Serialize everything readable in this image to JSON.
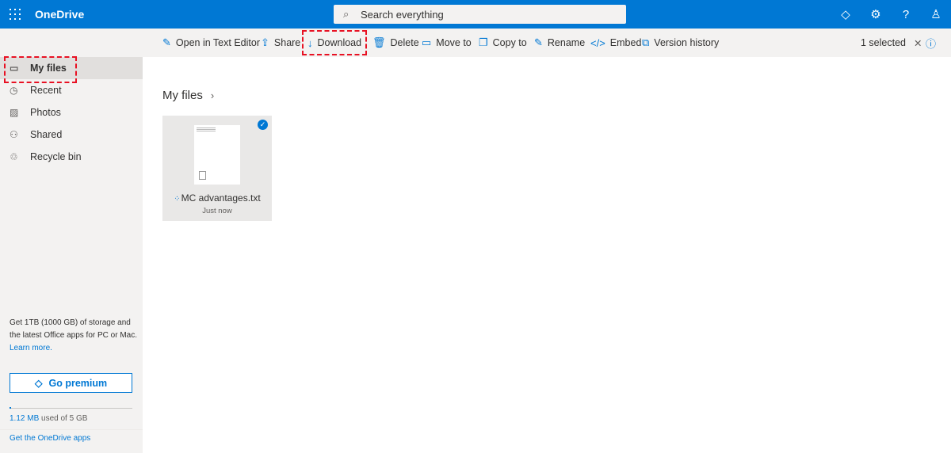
{
  "header": {
    "app_name": "OneDrive",
    "search_placeholder": "Search everything",
    "icons": [
      "diamond-icon",
      "gear-icon",
      "help-icon",
      "person-icon"
    ]
  },
  "toolbar": {
    "open_text_editor": "Open in Text Editor",
    "share": "Share",
    "download": "Download",
    "delete": "Delete",
    "move_to": "Move to",
    "copy_to": "Copy to",
    "rename": "Rename",
    "embed": "Embed",
    "version_history": "Version history",
    "selected": "1 selected"
  },
  "sidebar": {
    "items": [
      {
        "label": "My files",
        "icon": "folder-icon"
      },
      {
        "label": "Recent",
        "icon": "clock-icon"
      },
      {
        "label": "Photos",
        "icon": "image-icon"
      },
      {
        "label": "Shared",
        "icon": "people-icon"
      },
      {
        "label": "Recycle bin",
        "icon": "trash-icon"
      }
    ],
    "promo": "Get 1TB (1000 GB) of storage and the latest Office apps for PC or Mac.",
    "learn_more": "Learn more.",
    "go_premium": "Go premium",
    "storage_used": "1.12 MB",
    "storage_rest": "used of 5 GB",
    "storage_fraction": 0.0002,
    "get_apps": "Get the OneDrive apps"
  },
  "main": {
    "breadcrumb": "My files",
    "files": [
      {
        "name": "MC advantages.txt",
        "date": "Just now",
        "selected": true
      }
    ]
  },
  "colors": {
    "accent": "#0078d4",
    "highlight": "#e81123"
  }
}
